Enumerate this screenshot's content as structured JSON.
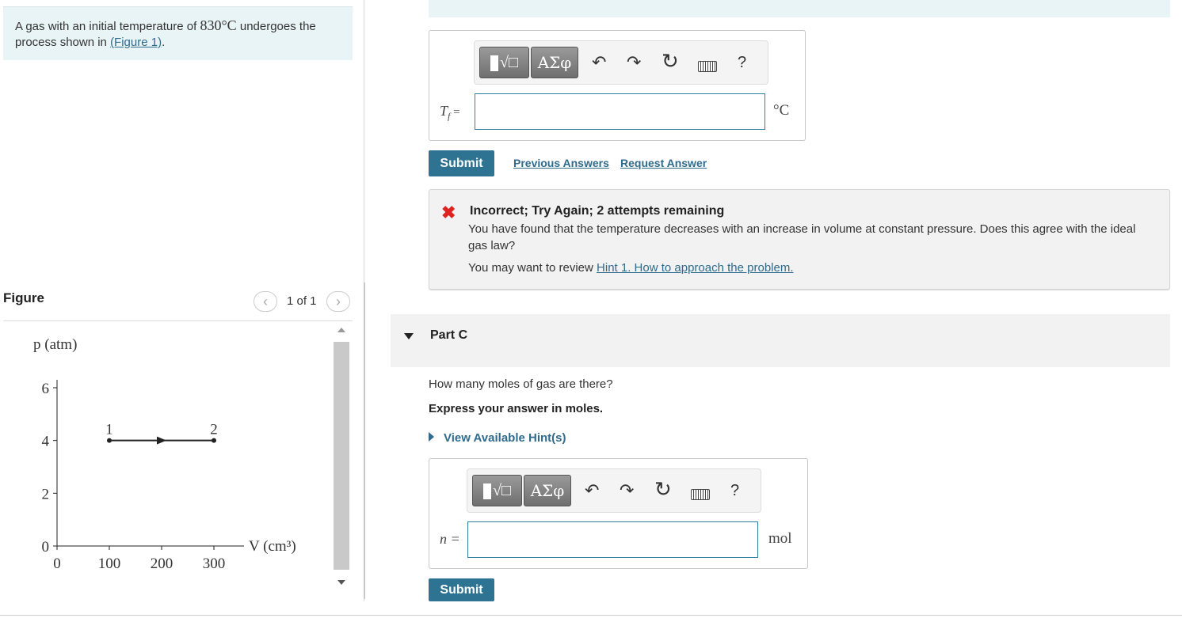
{
  "problem": {
    "text_before": "A gas with an initial temperature of ",
    "temperature": "830°",
    "unit": "C",
    "text_after": " undergoes the process shown in ",
    "figure_link": "(Figure 1)",
    "period": "."
  },
  "figure": {
    "title": "Figure",
    "counter": "1 of 1",
    "prev_icon": "chevron-left-icon",
    "next_icon": "chevron-right-icon"
  },
  "part_b": {
    "variable": "Tf =",
    "unit": "°C",
    "input_value": "",
    "submit": "Submit",
    "previous_answers": "Previous Answers",
    "request_answer": "Request Answer"
  },
  "toolbar": {
    "templates_icon": "math-templates-icon",
    "greek_label": "ΑΣφ",
    "undo_glyph": "↶",
    "redo_glyph": "↷",
    "reset_glyph": "↻",
    "keyboard_icon": "keyboard-icon",
    "help_label": "?"
  },
  "feedback": {
    "icon": "close-icon",
    "color": "#dd2222",
    "title": "Incorrect; Try Again; 2 attempts remaining",
    "body": "You have found that the temperature decreases with an increase in volume at constant pressure. Does this agree with the ideal gas law?",
    "review_prefix": "You may want to review ",
    "hint_link": "Hint 1. How to approach the problem."
  },
  "part_c": {
    "title": "Part C",
    "question": "How many moles of gas are there?",
    "instruction": "Express your answer in moles.",
    "hints": "View Available Hint(s)",
    "variable": "n =",
    "unit": "mol",
    "input_value": "",
    "submit": "Submit"
  },
  "chart_data": {
    "type": "line",
    "xlabel": "V (cm³)",
    "ylabel": "p (atm)",
    "x_ticks": [
      "0",
      "100",
      "200",
      "300"
    ],
    "y_ticks": [
      "0",
      "2",
      "4",
      "6"
    ],
    "xlim": [
      0,
      300
    ],
    "ylim": [
      0,
      6
    ],
    "series": [
      {
        "points": [
          {
            "x": 100,
            "y": 4,
            "label": "1"
          },
          {
            "x": 300,
            "y": 4,
            "label": "2"
          }
        ],
        "arrow_direction": "right"
      }
    ]
  },
  "colors": {
    "accent": "#2f7393",
    "link": "#2e6b8c",
    "banner": "#e9f4f7"
  }
}
